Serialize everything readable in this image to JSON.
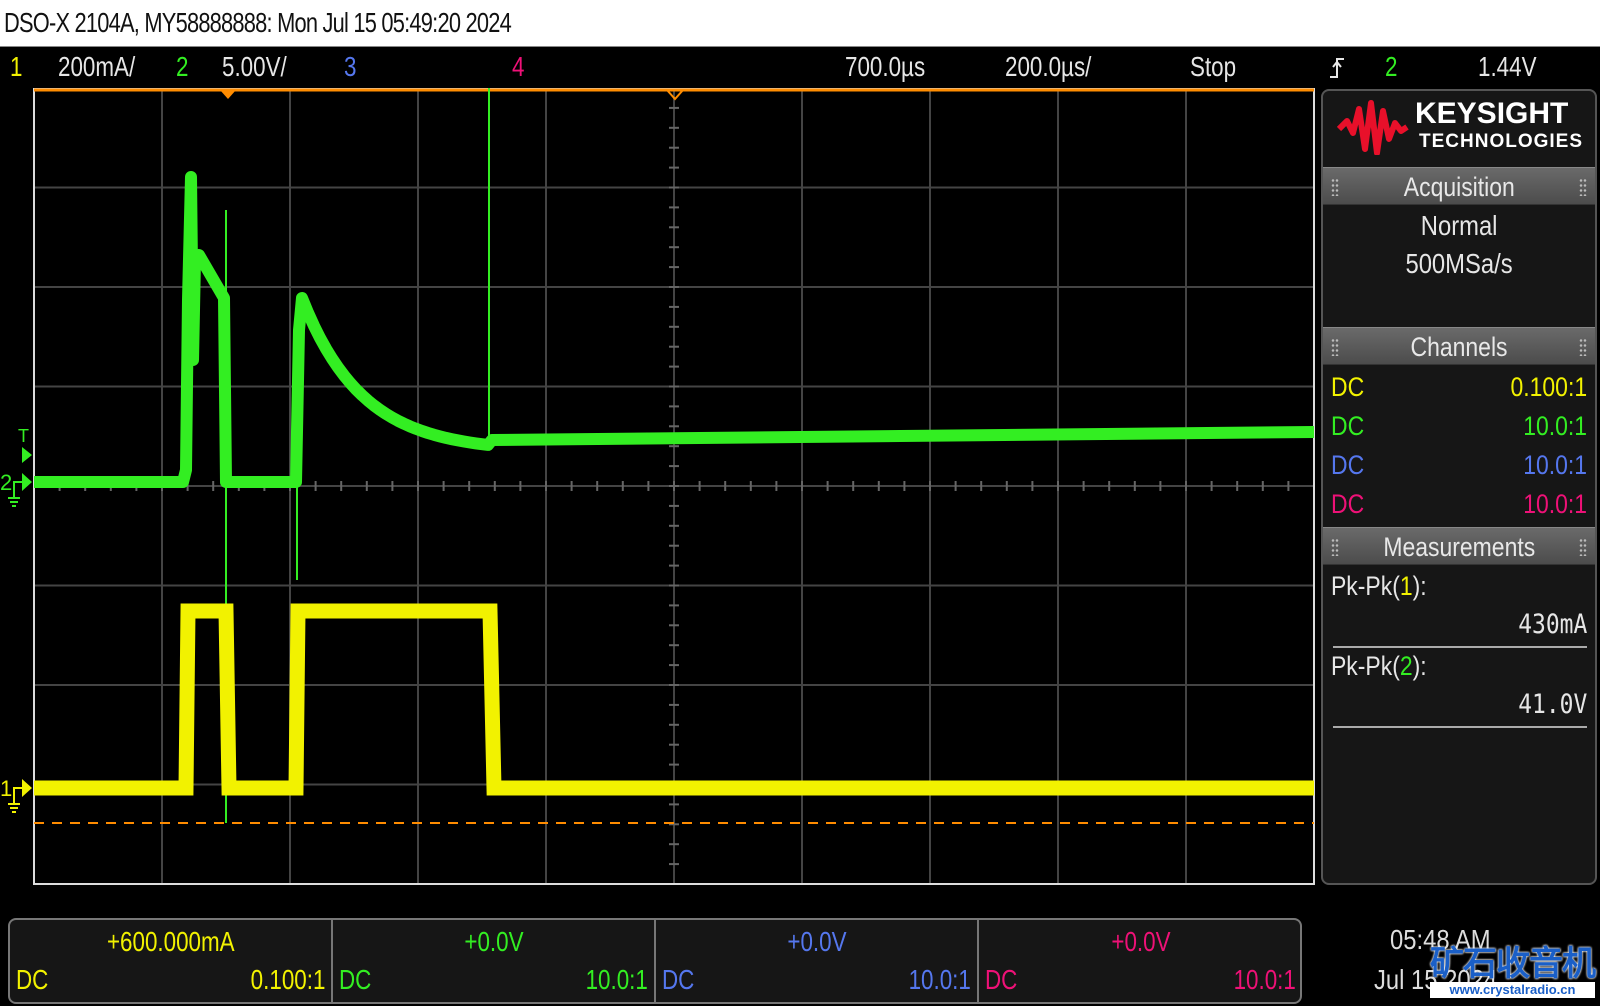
{
  "title": "DSO-X 2104A, MY58888888: Mon Jul 15 05:49:20 2024",
  "header": {
    "ch1_label": "1",
    "ch1_scale": "200mA/",
    "ch2_label": "2",
    "ch2_scale": "5.00V/",
    "ch3_label": "3",
    "ch4_label": "4",
    "time_delay": "700.0µs",
    "time_scale": "200.0µs/",
    "run_state": "Stop",
    "trigger_edge_icon": "rising-edge",
    "trigger_source": "2",
    "trigger_level": "1.44V"
  },
  "colors": {
    "ch1": "#f2f200",
    "ch2": "#33ee22",
    "ch3": "#5577ee",
    "ch4": "#ee1177",
    "trigger": "#ff8c00",
    "grid": "#444444"
  },
  "plot": {
    "markers": {
      "ch1": "1",
      "ch2": "2",
      "trigger": "T"
    }
  },
  "panel": {
    "logo": {
      "brand": "KEYSIGHT",
      "sub": "TECHNOLOGIES"
    },
    "acquisition": {
      "title": "Acquisition",
      "mode": "Normal",
      "rate": "500MSa/s"
    },
    "channels": {
      "title": "Channels",
      "rows": [
        {
          "coupling": "DC",
          "probe": "0.100:1"
        },
        {
          "coupling": "DC",
          "probe": "10.0:1"
        },
        {
          "coupling": "DC",
          "probe": "10.0:1"
        },
        {
          "coupling": "DC",
          "probe": "10.0:1"
        }
      ]
    },
    "measurements": {
      "title": "Measurements",
      "items": [
        {
          "prefix": "Pk-Pk(",
          "ch": "1",
          "suffix": "):",
          "value": "430mA"
        },
        {
          "prefix": "Pk-Pk(",
          "ch": "2",
          "suffix": "):",
          "value": "41.0V"
        }
      ]
    }
  },
  "bottom": [
    {
      "offset": "+600.000mA",
      "coupling": "DC",
      "probe": "0.100:1"
    },
    {
      "offset": "+0.0V",
      "coupling": "DC",
      "probe": "10.0:1"
    },
    {
      "offset": "+0.0V",
      "coupling": "DC",
      "probe": "10.0:1"
    },
    {
      "offset": "+0.0V",
      "coupling": "DC",
      "probe": "10.0:1"
    }
  ],
  "clock": {
    "time": "05:48 AM",
    "date": "Jul 15 2024"
  },
  "watermark": {
    "cn": "矿石收音机",
    "url": "www.crystalradio.cn"
  }
}
